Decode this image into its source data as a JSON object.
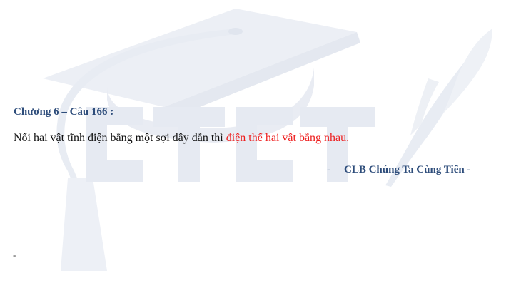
{
  "question": {
    "heading": "Chương 6 – Câu 166 :",
    "text_plain": "Nối hai vật tĩnh điện bằng một sợi dây dẫn thì ",
    "text_highlight": "điện thế hai vật bằng nhau.",
    "highlight_color": "#ee1c1c",
    "heading_color": "#2e4d7b"
  },
  "signature": {
    "dash": "-",
    "name": "CLB Chúng Ta Cùng Tiến -"
  },
  "trailing_mark": "-",
  "watermark": {
    "icon": "graduation-cap-quill-logo",
    "color": "#e7ebf2"
  }
}
